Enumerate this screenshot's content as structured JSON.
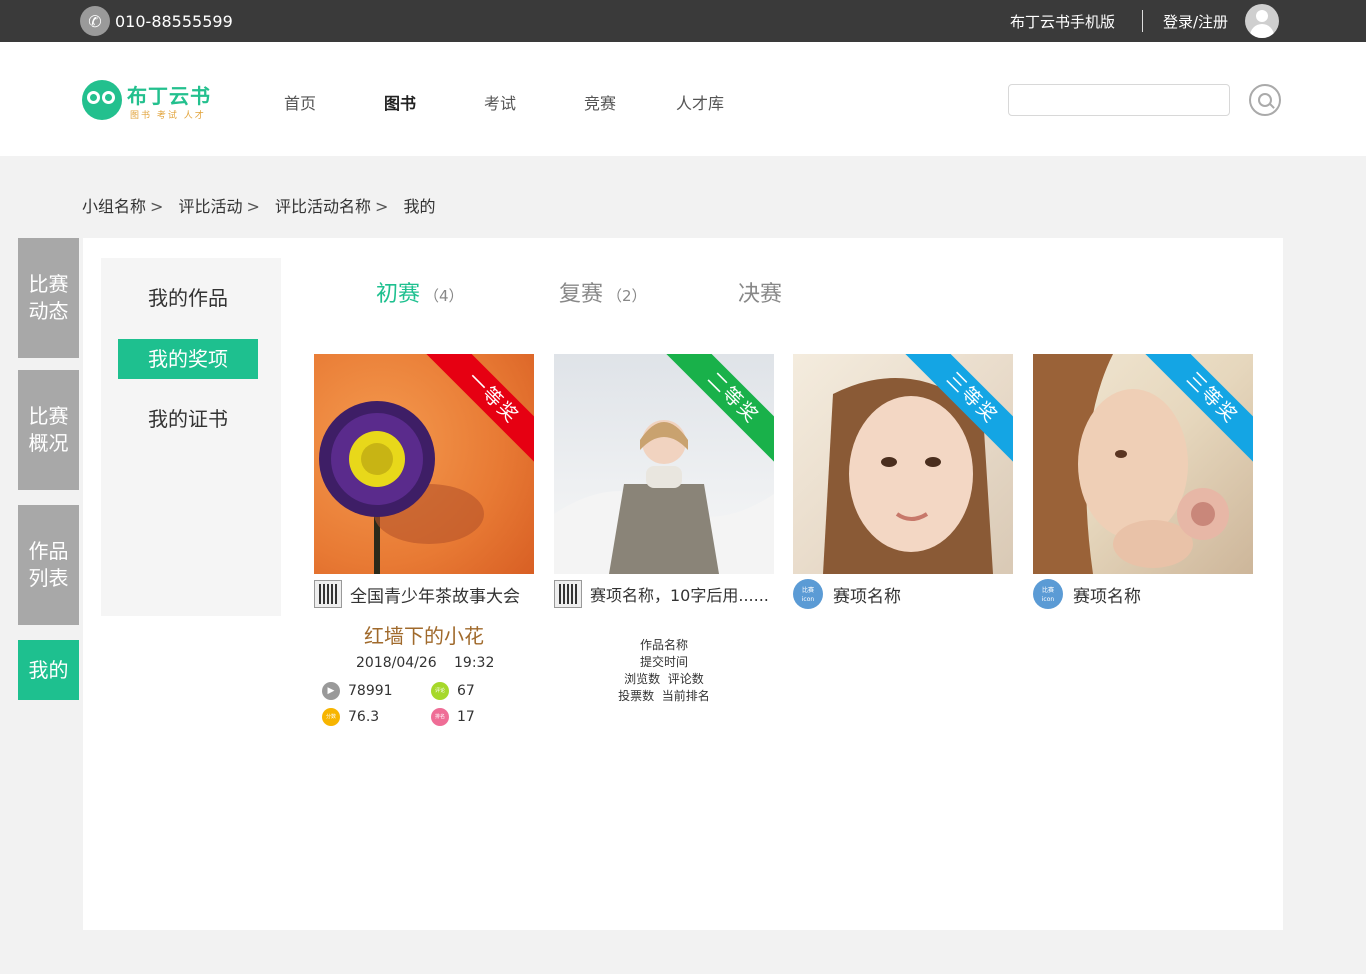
{
  "topbar": {
    "phone": "010-88555599",
    "mobile_link": "布丁云书手机版",
    "login_link": "登录/注册"
  },
  "header": {
    "logo_text": "布丁云书",
    "logo_sub": "图书 考试 人才",
    "nav": [
      "首页",
      "图书",
      "考试",
      "竞赛",
      "人才库"
    ],
    "active_nav": "图书"
  },
  "breadcrumb": [
    "小组名称",
    "评比活动",
    "评比活动名称",
    "我的"
  ],
  "side_tabs": [
    {
      "lines": [
        "比赛",
        "动态"
      ],
      "active": false
    },
    {
      "lines": [
        "比赛",
        "概况"
      ],
      "active": false
    },
    {
      "lines": [
        "作品",
        "列表"
      ],
      "active": false
    },
    {
      "lines": [
        "我的"
      ],
      "active": true
    }
  ],
  "submenu": [
    "我的作品",
    "我的奖项",
    "我的证书"
  ],
  "submenu_active": "我的奖项",
  "stages": [
    {
      "label": "初赛",
      "count": "（4）",
      "active": true
    },
    {
      "label": "复赛",
      "count": "（2）",
      "active": false
    },
    {
      "label": "决赛",
      "count": "",
      "active": false
    }
  ],
  "cards": [
    {
      "title": "全国青少年茶故事大会",
      "ribbon": "一等奖",
      "ribbon_color": "#e60012",
      "icon": "accordion-icon"
    },
    {
      "title": "赛项名称，10字后用......",
      "ribbon": "二等奖",
      "ribbon_color": "#19b14a",
      "icon": "accordion-icon"
    },
    {
      "title": "赛项名称",
      "ribbon": "三等奖",
      "ribbon_color": "#14a5e4",
      "icon": "badge-icon",
      "badge_top": "比赛",
      "badge_bottom": "icon"
    },
    {
      "title": "赛项名称",
      "ribbon": "三等奖",
      "ribbon_color": "#14a5e4",
      "icon": "badge-icon",
      "badge_top": "比赛",
      "badge_bottom": "icon"
    }
  ],
  "work": {
    "name": "红墙下的小花",
    "date": "2018/04/26",
    "time": "19:32",
    "views": "78991",
    "comments": "67",
    "score": "76.3",
    "rank": "17",
    "comments_icon_label": "评论",
    "score_icon_label": "分数",
    "rank_icon_label": "排名"
  },
  "legend": [
    "作品名称",
    "提交时间",
    "浏览数  评论数",
    "投票数  当前排名"
  ]
}
